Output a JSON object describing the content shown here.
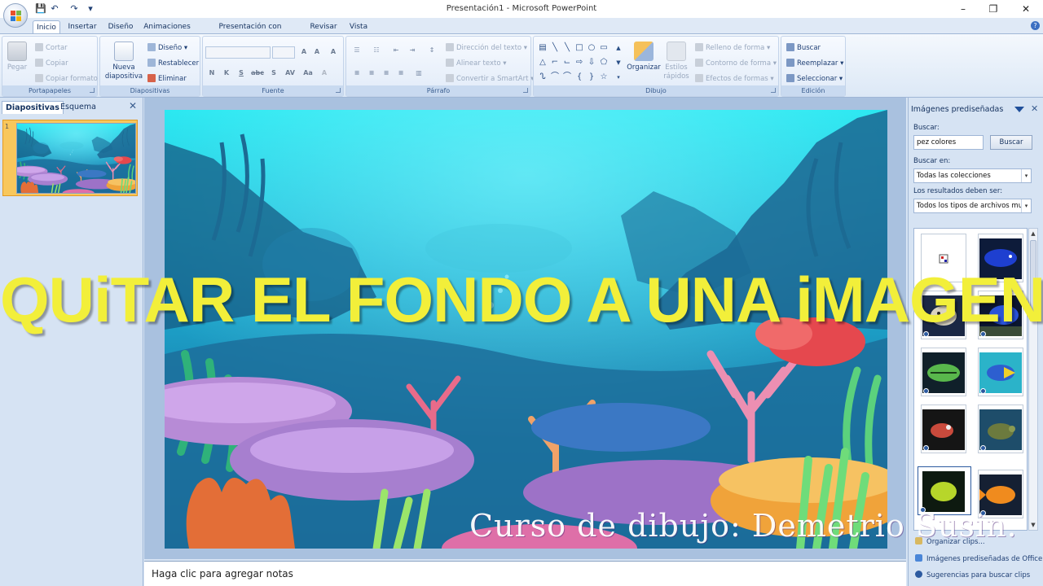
{
  "window": {
    "title": "Presentación1 - Microsoft PowerPoint",
    "minimize": "–",
    "maximize": "❐",
    "close": "✕"
  },
  "quick_access": {
    "save": "💾",
    "undo": "↶",
    "redo": "↷",
    "customize": "▾"
  },
  "ribbon": {
    "tabs": [
      "Inicio",
      "Insertar",
      "Diseño",
      "Animaciones",
      "Presentación con diapositivas",
      "Revisar",
      "Vista"
    ],
    "active_tab": "Inicio",
    "clipboard": {
      "paste": "Pegar",
      "cut": "Cortar",
      "copy": "Copiar",
      "format_painter": "Copiar formato",
      "label": "Portapapeles"
    },
    "slides": {
      "new_slide": "Nueva diapositiva",
      "layout": "Diseño",
      "reset": "Restablecer",
      "delete": "Eliminar",
      "label": "Diapositivas"
    },
    "font": {
      "label": "Fuente",
      "bold": "N",
      "italic": "K",
      "underline": "S",
      "strike": "abc",
      "shadow": "S",
      "spacing": "AV",
      "case": "Aa",
      "grow": "A",
      "shrink": "A",
      "clear": "A"
    },
    "paragraph": {
      "text_direction": "Dirección del texto",
      "align_text": "Alinear texto",
      "smartart": "Convertir a SmartArt",
      "label": "Párrafo"
    },
    "drawing": {
      "arrange": "Organizar",
      "quick_styles": "Estilos rápidos",
      "shape_fill": "Relleno de forma",
      "shape_outline": "Contorno de forma",
      "shape_effects": "Efectos de formas",
      "label": "Dibujo"
    },
    "editing": {
      "find": "Buscar",
      "replace": "Reemplazar",
      "select": "Seleccionar",
      "label": "Edición"
    }
  },
  "left_pane": {
    "tabs": [
      "Diapositivas",
      "Esquema"
    ],
    "close": "✕",
    "slide_number": "1"
  },
  "notes": {
    "placeholder": "Haga clic para agregar notas"
  },
  "clip_art": {
    "title": "Imágenes prediseñadas",
    "close": "✕",
    "search_label": "Buscar:",
    "search_value": "pez colores",
    "search_button": "Buscar",
    "search_in_label": "Buscar en:",
    "search_in_value": "Todas las colecciones",
    "results_type_label": "Los resultados deben ser:",
    "results_type_value": "Todos los tipos de archivos multir",
    "links": [
      "Organizar clips...",
      "Imágenes prediseñadas de Office On",
      "Sugerencias para buscar clips"
    ],
    "result_items": [
      {
        "name": "small-glyph"
      },
      {
        "name": "blue-fish"
      },
      {
        "name": "pufferfish"
      },
      {
        "name": "blue-fish-photo"
      },
      {
        "name": "green-fish"
      },
      {
        "name": "yellow-tang"
      },
      {
        "name": "red-fish"
      },
      {
        "name": "turtle"
      },
      {
        "name": "yellow-fish"
      },
      {
        "name": "goldfish"
      }
    ]
  },
  "overlay": {
    "headline": "QUiTAR EL FONDO A UNA iMAGEN",
    "credit": "Curso de dibujo: Demetrio Susin."
  },
  "colors": {
    "headline": "#f2ef3a",
    "ribbon_bg": "#dce8f6",
    "selected_thumb": "#f8c75c"
  }
}
